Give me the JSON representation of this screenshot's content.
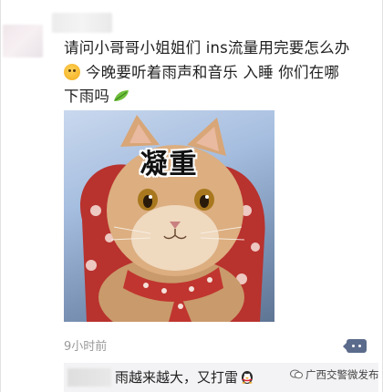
{
  "post": {
    "line1": "请问小哥哥小姐姐们 ins流量用完要怎么办",
    "line2": "今晚要听着雨声和音乐 入睡 你们在哪",
    "line3": "下雨吗",
    "emoji_start": "smiling-face-icon",
    "emoji_end": "leaf-icon"
  },
  "image": {
    "caption": "凝重",
    "subject": "cat-photo"
  },
  "meta": {
    "time": "9小时前"
  },
  "comment": {
    "text": "雨越来越大，又打雷"
  },
  "watermark": {
    "text": "广西交警微发布"
  },
  "colors": {
    "more_button": "#5b6b8c",
    "comment_bg": "#f3f3f5",
    "timestamp": "#9a9a9a"
  }
}
